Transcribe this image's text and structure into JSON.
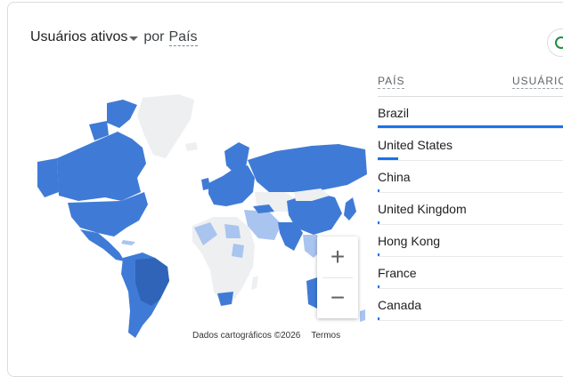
{
  "header": {
    "metric": "Usuários ativos",
    "connector": "por",
    "dimension": "País"
  },
  "map": {
    "attribution": "Dados cartográficos ©2026",
    "terms": "Termos",
    "zoom_in": "+",
    "zoom_out": "−"
  },
  "table": {
    "col_country": "PAÍS",
    "col_users": "USUÁRIOS",
    "rows": [
      {
        "country": "Brazil",
        "share": 1.0
      },
      {
        "country": "United States",
        "share": 0.11
      },
      {
        "country": "China",
        "share": 0.01
      },
      {
        "country": "United Kingdom",
        "share": 0.01
      },
      {
        "country": "Hong Kong",
        "share": 0.01
      },
      {
        "country": "France",
        "share": 0.01
      },
      {
        "country": "Canada",
        "share": 0.005
      }
    ]
  },
  "colors": {
    "accent": "#1a73e8",
    "map_high": "#2f64b9",
    "map_mid": "#3f7bd6",
    "map_low": "#a9c4ef",
    "map_none": "#eeeff1",
    "status_ok": "#1e8e3e"
  }
}
